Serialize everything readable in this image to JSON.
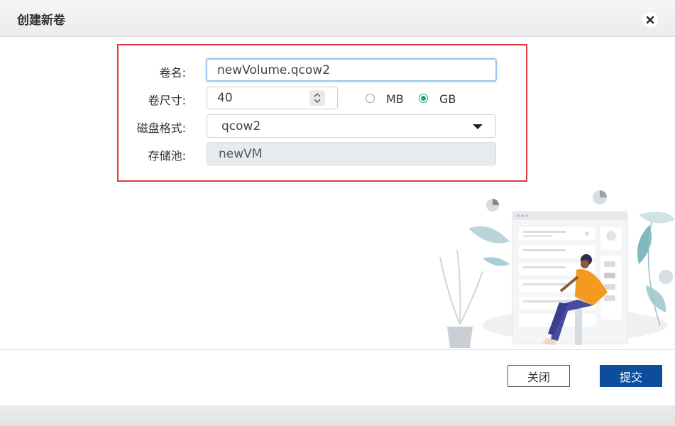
{
  "dialog": {
    "title": "创建新卷"
  },
  "form": {
    "volume_name": {
      "label": "卷名:",
      "value": "newVolume.qcow2"
    },
    "volume_size": {
      "label": "卷尺寸:",
      "value": "40"
    },
    "units": [
      {
        "label": "MB",
        "checked": false
      },
      {
        "label": "GB",
        "checked": true
      }
    ],
    "disk_format": {
      "label": "磁盘格式:",
      "value": "qcow2"
    },
    "storage_pool": {
      "label": "存储池:",
      "value": "newVM"
    }
  },
  "footer": {
    "close_label": "关闭",
    "submit_label": "提交"
  },
  "colors": {
    "highlight_border": "#e0393e",
    "submit_button": "#0d4d9c",
    "radio_checked": "#1aa58a"
  },
  "icons": {
    "close": "close-icon",
    "spinner": "spinner-arrows-icon",
    "dropdown": "caret-down-icon"
  }
}
